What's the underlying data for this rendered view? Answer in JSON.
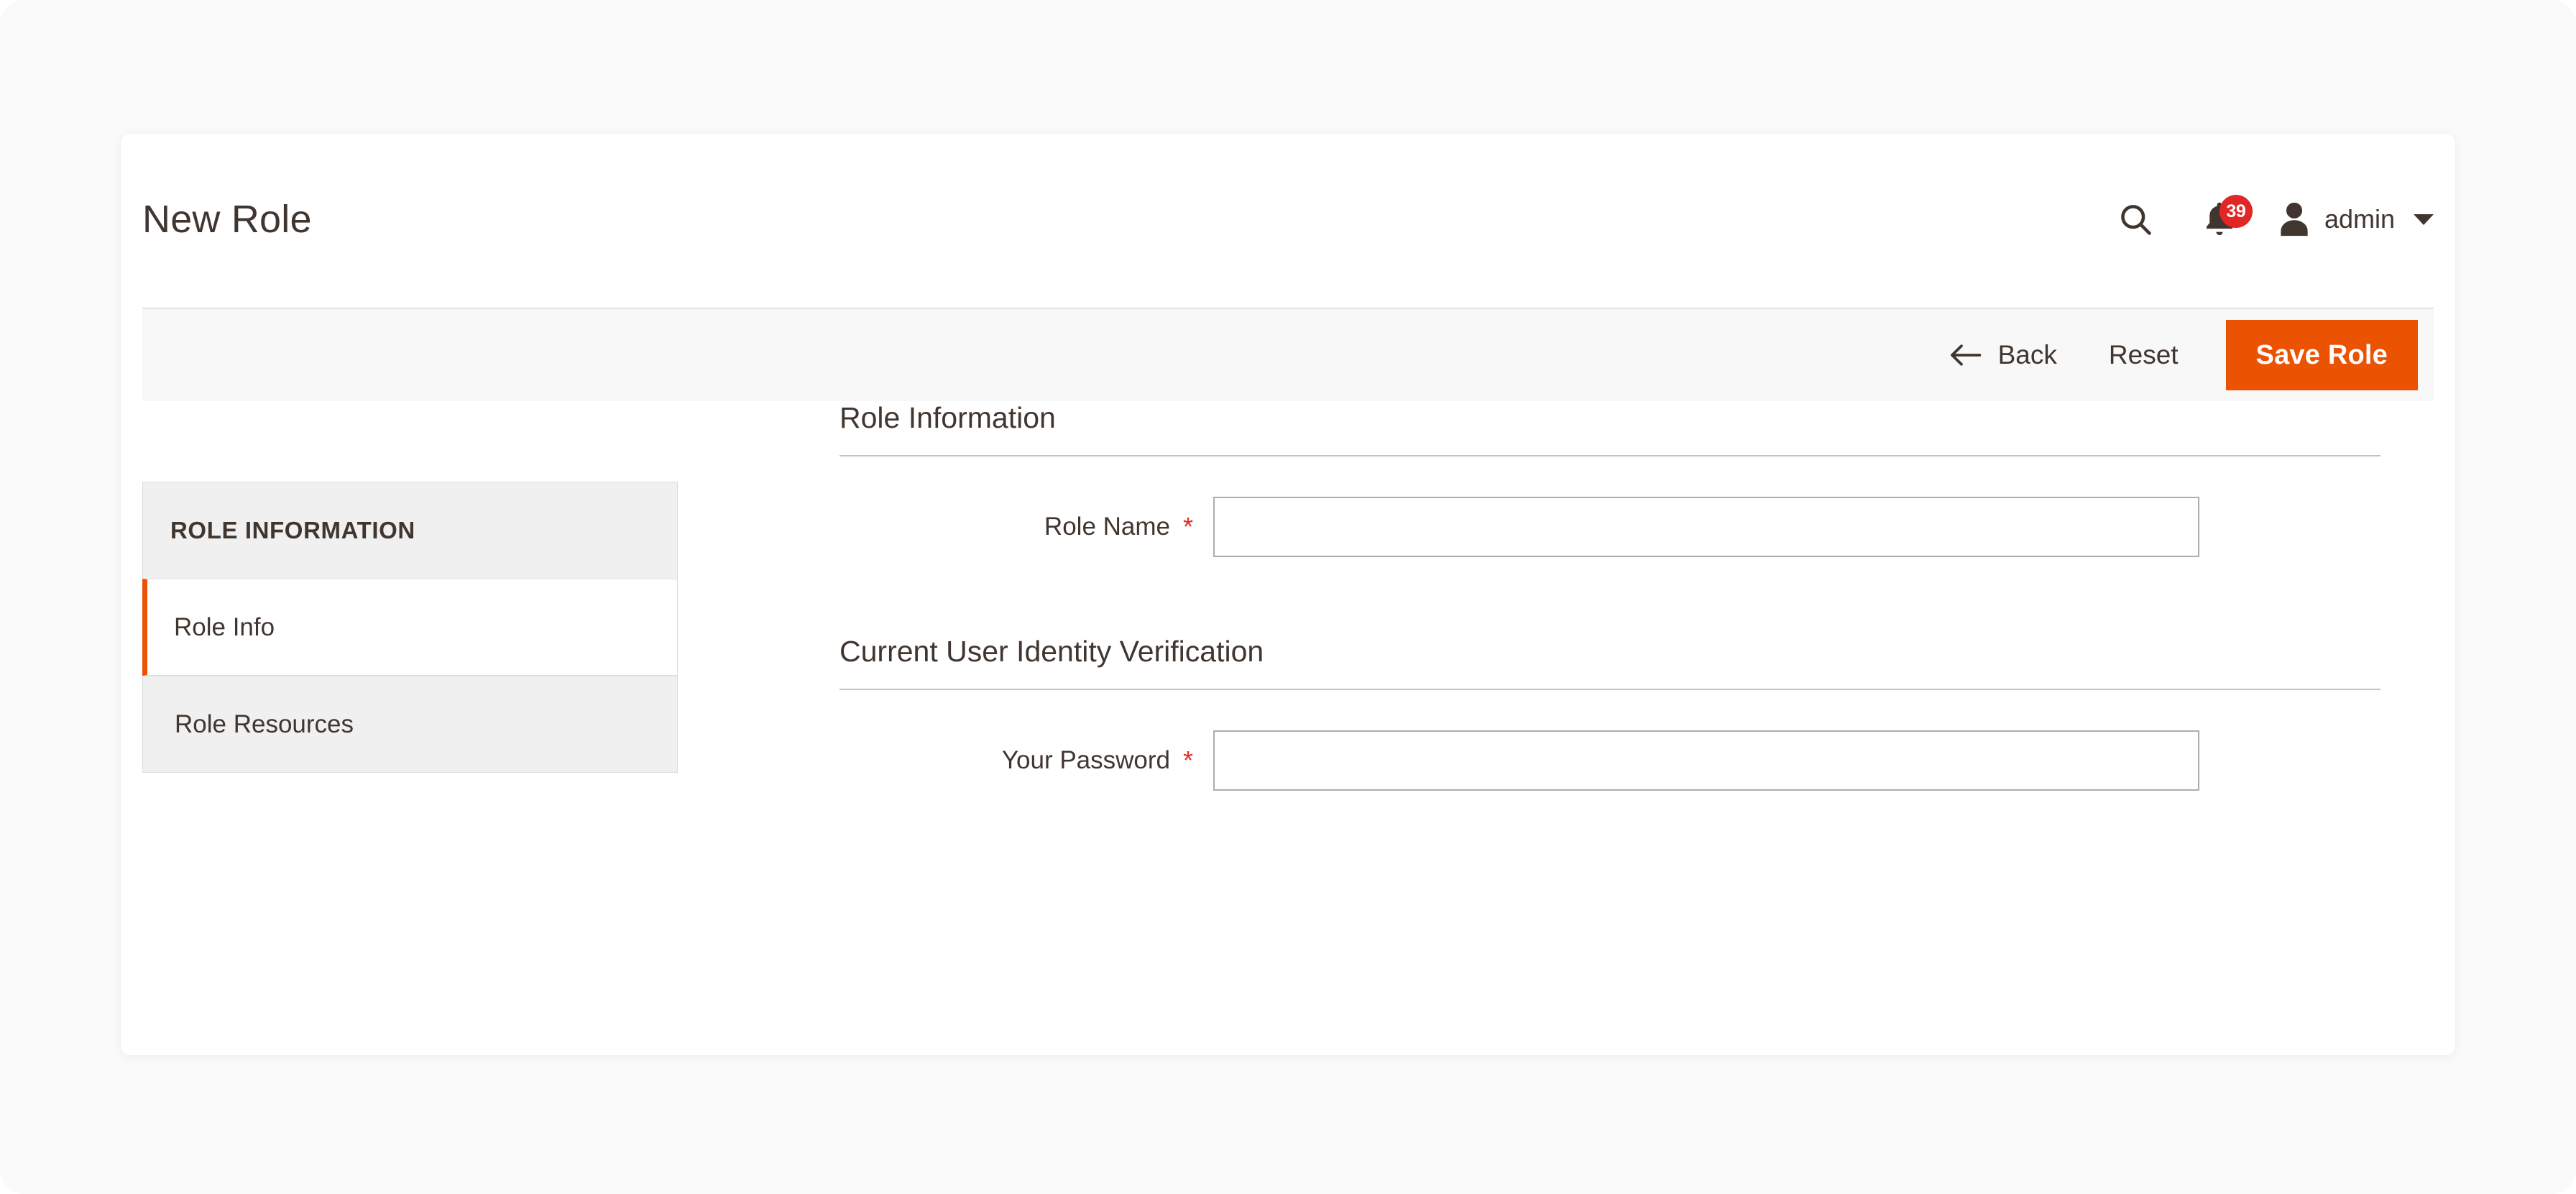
{
  "page": {
    "title": "New Role",
    "background_color": "#fafafa",
    "accent_color": "#eb5202"
  },
  "header": {
    "title": "New Role",
    "search_icon": "search-icon",
    "notifications": {
      "icon": "bell-icon",
      "badge_count": "39",
      "badge_color": "#e22626"
    },
    "user": {
      "avatar_icon": "user-avatar-icon",
      "name": "admin",
      "caret_icon": "chevron-down-icon"
    }
  },
  "toolbar": {
    "back_icon": "arrow-left-icon",
    "back_label": "Back",
    "reset_label": "Reset",
    "save_label": "Save Role"
  },
  "sidebar": {
    "title": "ROLE INFORMATION",
    "items": [
      {
        "label": "Role Info",
        "active": true
      },
      {
        "label": "Role Resources",
        "active": false
      }
    ]
  },
  "form": {
    "sections": [
      {
        "legend": "Role Information",
        "fields": [
          {
            "label": "Role Name",
            "required": "*",
            "value": "",
            "placeholder": "",
            "type": "text"
          }
        ]
      },
      {
        "legend": "Current User Identity Verification",
        "fields": [
          {
            "label": "Your Password",
            "required": "*",
            "value": "",
            "placeholder": "",
            "type": "password"
          }
        ]
      }
    ]
  }
}
